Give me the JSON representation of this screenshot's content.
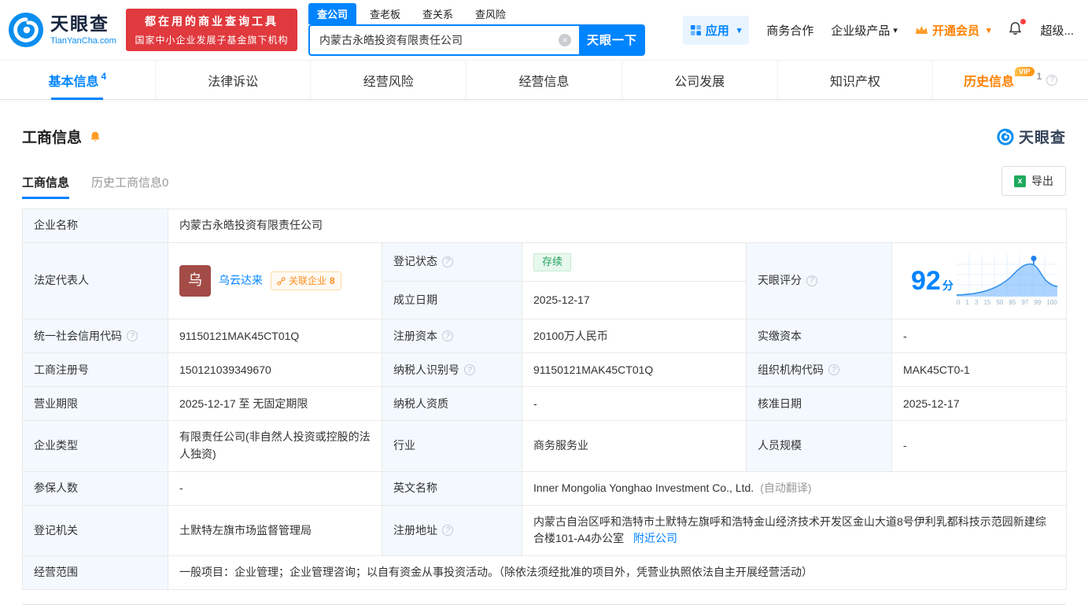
{
  "brand": {
    "name": "天眼查",
    "domain": "TianYanCha.com",
    "accent_color": "#0084ff",
    "orange_color": "#ff8000",
    "promo_red": "#e0393e",
    "label_bg": "#f3f9ff",
    "status_green": "#23a35f",
    "avatar_color": "#a34b47"
  },
  "promo": {
    "line1": "都在用的商业查询工具",
    "line2": "国家中小企业发展子基金旗下机构"
  },
  "search": {
    "tabs": [
      {
        "label": "查公司"
      },
      {
        "label": "查老板"
      },
      {
        "label": "查关系"
      },
      {
        "label": "查风险"
      }
    ],
    "value": "内蒙古永皓投资有限责任公司",
    "button": "天眼一下"
  },
  "top_menu": {
    "apps": "应用",
    "cooperation": "商务合作",
    "enterprise_products": "企业级产品",
    "membership": "开通会员",
    "super": "超级..."
  },
  "nav_tabs": [
    {
      "label": "基本信息",
      "count": "4"
    },
    {
      "label": "法律诉讼"
    },
    {
      "label": "经营风险"
    },
    {
      "label": "经营信息"
    },
    {
      "label": "公司发展"
    },
    {
      "label": "知识产权"
    },
    {
      "label": "历史信息",
      "count": "1",
      "badge": "VIP"
    }
  ],
  "section": {
    "title": "工商信息",
    "watermark": "天眼查",
    "tabs": [
      {
        "label": "工商信息"
      },
      {
        "label": "历史工商信息0"
      }
    ],
    "export_label": "导出"
  },
  "fields": {
    "company_name": {
      "label": "企业名称",
      "value": "内蒙古永皓投资有限责任公司"
    },
    "legal_rep": {
      "label": "法定代表人",
      "avatar": "乌",
      "name": "乌云达来",
      "related_label": "关联企业",
      "related_count": "8"
    },
    "reg_status": {
      "label": "登记状态",
      "value": "存续"
    },
    "establish_date": {
      "label": "成立日期",
      "value": "2025-12-17"
    },
    "score": {
      "label": "天眼评分",
      "value": "92",
      "unit": "分",
      "axis": [
        "0",
        "1",
        "3",
        "15",
        "50",
        "85",
        "97",
        "99",
        "100"
      ]
    },
    "credit_code": {
      "label": "统一社会信用代码",
      "value": "91150121MAK45CT01Q"
    },
    "reg_capital": {
      "label": "注册资本",
      "value": "20100万人民币"
    },
    "paid_capital": {
      "label": "实缴资本",
      "value": "-"
    },
    "reg_number": {
      "label": "工商注册号",
      "value": "150121039349670"
    },
    "taxpayer_id": {
      "label": "纳税人识别号",
      "value": "91150121MAK45CT01Q"
    },
    "org_code": {
      "label": "组织机构代码",
      "value": "MAK45CT0-1"
    },
    "business_term": {
      "label": "营业期限",
      "value": "2025-12-17 至 无固定期限"
    },
    "taxpayer_quality": {
      "label": "纳税人资质",
      "value": "-"
    },
    "approval_date": {
      "label": "核准日期",
      "value": "2025-12-17"
    },
    "company_type": {
      "label": "企业类型",
      "value": "有限责任公司(非自然人投资或控股的法人独资)"
    },
    "industry": {
      "label": "行业",
      "value": "商务服务业"
    },
    "staff_size": {
      "label": "人员规模",
      "value": "-"
    },
    "insured_count": {
      "label": "参保人数",
      "value": "-"
    },
    "english_name": {
      "label": "英文名称",
      "value": "Inner Mongolia Yonghao Investment Co., Ltd.",
      "note": "(自动翻译)"
    },
    "registry": {
      "label": "登记机关",
      "value": "土默特左旗市场监督管理局"
    },
    "address": {
      "label": "注册地址",
      "value": "内蒙古自治区呼和浩特市土默特左旗呼和浩特金山经济技术开发区金山大道8号伊利乳都科技示范园新建综合楼101-A4办公室",
      "link": "附近公司"
    },
    "business_scope": {
      "label": "经营范围",
      "value": "一般项目：企业管理；企业管理咨询；以自有资金从事投资活动。（除依法须经批准的项目外，凭营业执照依法自主开展经营活动）"
    }
  }
}
